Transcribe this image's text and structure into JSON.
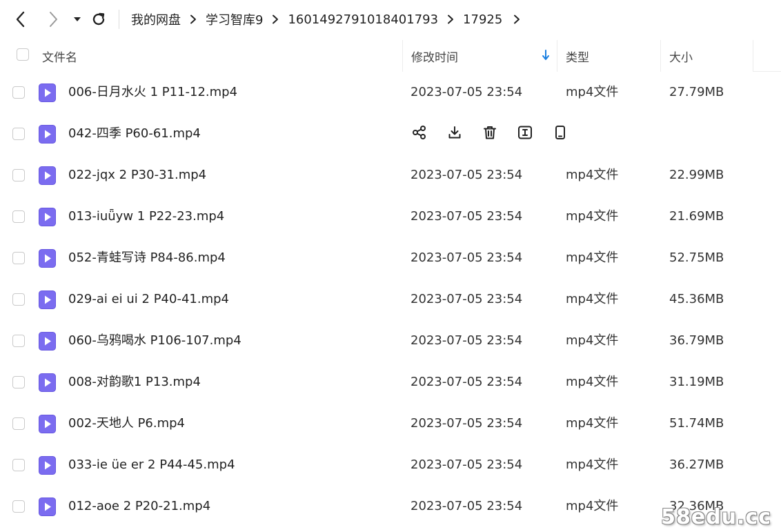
{
  "nav": {
    "back_icon": "chevron-left-icon",
    "forward_icon": "chevron-right-icon",
    "dropdown_icon": "caret-down-icon",
    "refresh_icon": "refresh-icon"
  },
  "breadcrumb": [
    "我的网盘",
    "学习智库9",
    "1601492791018401793",
    "17925"
  ],
  "columns": {
    "name": "文件名",
    "time": "修改时间",
    "type": "类型",
    "size": "大小",
    "sort_icon": "arrow-down-icon",
    "accent": "#1a7fe0"
  },
  "files": [
    {
      "name": "006-日月水火 1 P11-12.mp4",
      "time": "2023-07-05 23:54",
      "type": "mp4文件",
      "size": "27.79MB"
    },
    {
      "name": "042-四季 P60-61.mp4",
      "hover": true,
      "time": "",
      "type": "",
      "size": ""
    },
    {
      "name": "022-jqx 2 P30-31.mp4",
      "time": "2023-07-05 23:54",
      "type": "mp4文件",
      "size": "22.99MB"
    },
    {
      "name": "013-iuǖyw 1 P22-23.mp4",
      "time": "2023-07-05 23:54",
      "type": "mp4文件",
      "size": "21.69MB"
    },
    {
      "name": "052-青蛙写诗 P84-86.mp4",
      "time": "2023-07-05 23:54",
      "type": "mp4文件",
      "size": "52.75MB"
    },
    {
      "name": "029-ai ei ui 2 P40-41.mp4",
      "time": "2023-07-05 23:54",
      "type": "mp4文件",
      "size": "45.36MB"
    },
    {
      "name": "060-乌鸦喝水 P106-107.mp4",
      "time": "2023-07-05 23:54",
      "type": "mp4文件",
      "size": "36.79MB"
    },
    {
      "name": "008-对韵歌1 P13.mp4",
      "time": "2023-07-05 23:54",
      "type": "mp4文件",
      "size": "31.19MB"
    },
    {
      "name": "002-天地人 P6.mp4",
      "time": "2023-07-05 23:54",
      "type": "mp4文件",
      "size": "51.74MB"
    },
    {
      "name": "033-ie üe er 2 P44-45.mp4",
      "time": "2023-07-05 23:54",
      "type": "mp4文件",
      "size": "36.27MB"
    },
    {
      "name": "012-aoe 2 P20-21.mp4",
      "time": "2023-07-05 23:54",
      "type": "mp4文件",
      "size": "32.36MB"
    }
  ],
  "row_actions": [
    "share-icon",
    "download-icon",
    "delete-icon",
    "rename-icon",
    "phone-icon"
  ],
  "file_icon": "video-file-icon",
  "file_icon_color": "#7b6cf0",
  "watermark": "58edu.cc"
}
